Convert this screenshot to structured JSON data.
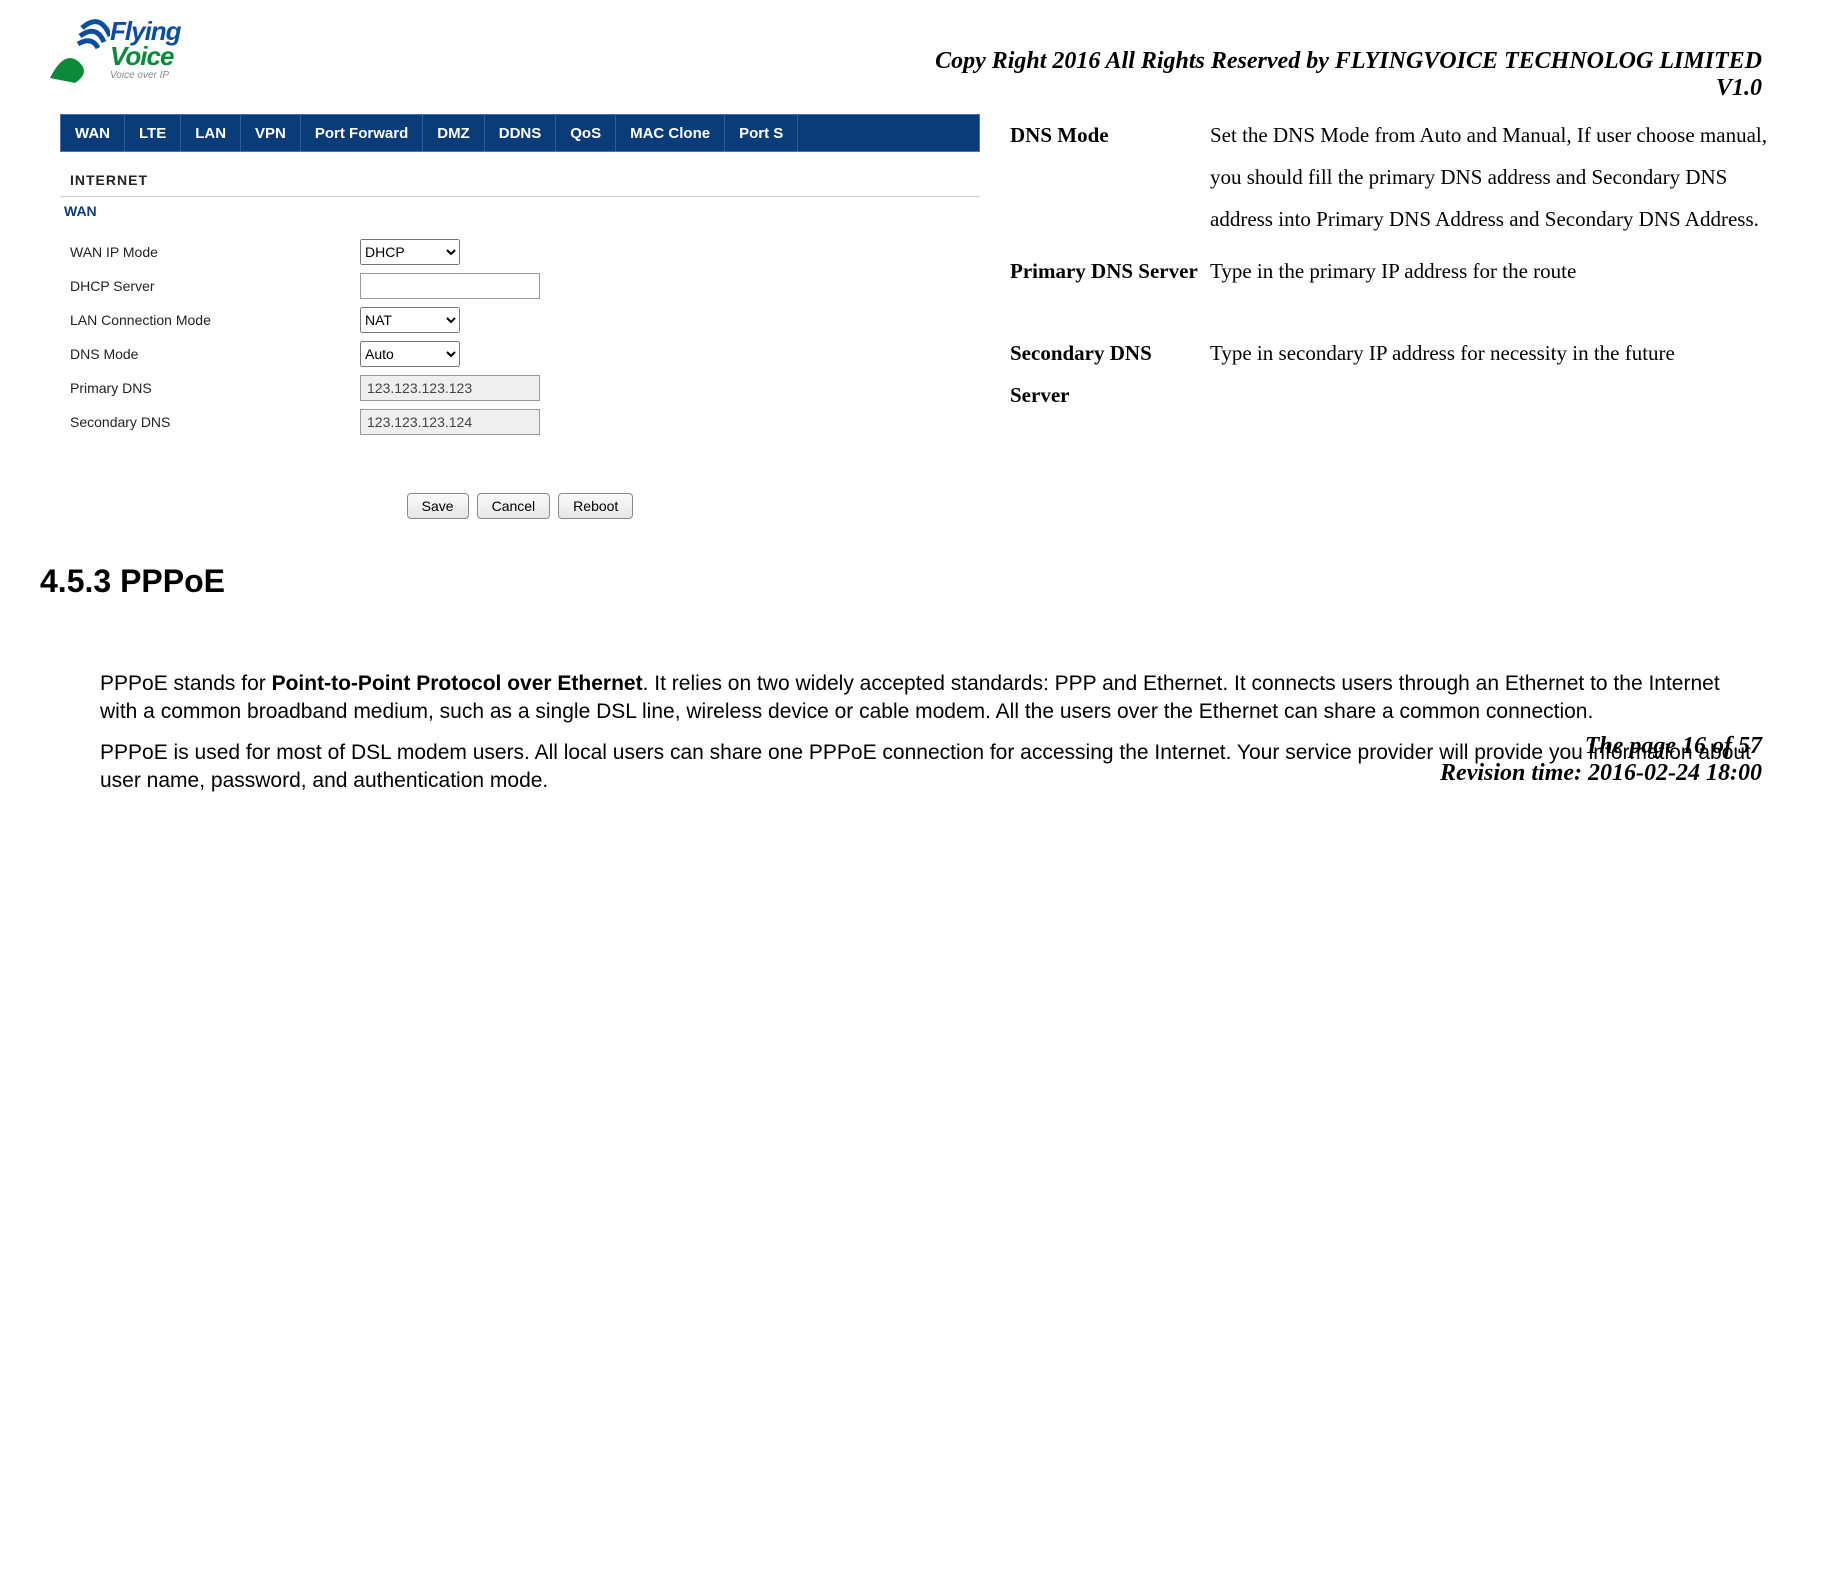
{
  "header": {
    "logo": {
      "line1": "Flying",
      "line2": "Voice",
      "tag": "Voice over IP"
    },
    "copyright": "Copy Right 2016 All Rights Reserved by FLYINGVOICE TECHNOLOG LIMITED",
    "version": "V1.0"
  },
  "admin": {
    "tabs": [
      "WAN",
      "LTE",
      "LAN",
      "VPN",
      "Port Forward",
      "DMZ",
      "DDNS",
      "QoS",
      "MAC Clone",
      "Port S"
    ],
    "section": "INTERNET",
    "crumb": "WAN",
    "rows": {
      "wan_ip_mode": {
        "label": "WAN IP Mode",
        "value": "DHCP"
      },
      "dhcp_server": {
        "label": "DHCP Server",
        "value": ""
      },
      "lan_conn_mode": {
        "label": "LAN Connection Mode",
        "value": "NAT"
      },
      "dns_mode": {
        "label": "DNS Mode",
        "value": "Auto"
      },
      "primary_dns": {
        "label": "Primary DNS",
        "value": "123.123.123.123"
      },
      "secondary_dns": {
        "label": "Secondary DNS",
        "value": "123.123.123.124"
      }
    },
    "buttons": {
      "save": "Save",
      "cancel": "Cancel",
      "reboot": "Reboot"
    }
  },
  "descriptions": {
    "dns_mode": {
      "label": "DNS Mode",
      "text": "Set the DNS Mode from Auto and Manual, If user choose manual, you should fill the primary DNS address and Secondary DNS address into Primary DNS Address and Secondary DNS Address."
    },
    "primary_dns": {
      "label": "Primary DNS Server",
      "text": "Type in the primary IP address for the route"
    },
    "secondary_dns": {
      "label": "Secondary DNS Server",
      "text": "Type in secondary IP address for necessity in the future"
    }
  },
  "section_title": "4.5.3 PPPoE",
  "para1_pre": "PPPoE stands for ",
  "para1_bold": "Point-to-Point Protocol over Ethernet",
  "para1_post": ". It relies on two widely accepted standards: PPP and Ethernet. It connects users through an Ethernet to the Internet with a common broadband medium, such as a single DSL line, wireless device or cable modem. All the users over the Ethernet can share a common connection.",
  "para2": "PPPoE is used for most of DSL modem users. All local users can share one PPPoE connection for accessing the Internet. Your service provider will provide you information about user name, password, and authentication mode.",
  "footer": {
    "page": "The page 16 of 57",
    "rev": "Revision time: 2016-02-24 18:00"
  }
}
